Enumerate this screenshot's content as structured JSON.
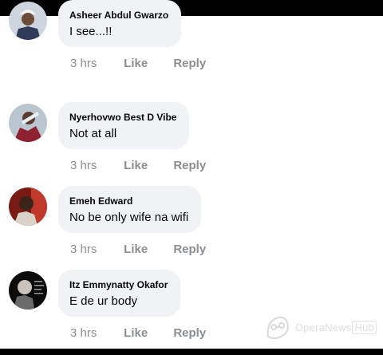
{
  "comments": [
    {
      "name": "Nyerhovwo Best D Vibe",
      "text": "Not at all",
      "time": "3 hrs",
      "like": "Like",
      "reply": "Reply"
    },
    {
      "name": "Emeh Edward",
      "text": "No be only wife na wifi",
      "time": "3 hrs",
      "like": "Like",
      "reply": "Reply"
    },
    {
      "name": "Itz Emmynatty Okafor",
      "text": "E de ur body",
      "time": "3 hrs",
      "like": "Like",
      "reply": "Reply"
    },
    {
      "name": "Asheer Abdul Gwarzo",
      "text": "I see...!!",
      "time": "3 hrs",
      "like": "Like",
      "reply": "Reply"
    }
  ],
  "watermark": {
    "brand": "OperaNews",
    "suffix": "Hub"
  }
}
